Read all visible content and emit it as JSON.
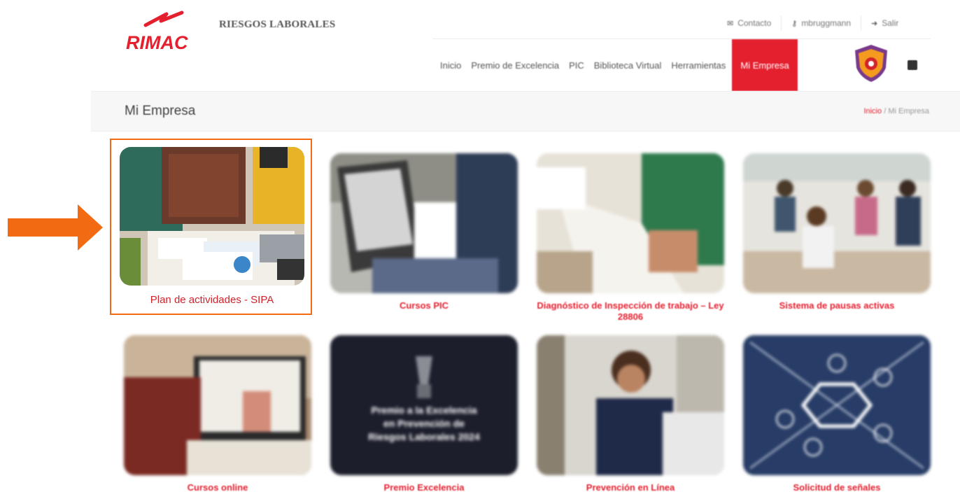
{
  "header": {
    "logo_text": "RIMAC",
    "subtitle": "RIESGOS LABORALES",
    "top_links": [
      {
        "label": "Contacto",
        "icon": "chat-icon"
      },
      {
        "label": "mbruggmann",
        "icon": "key-icon"
      },
      {
        "label": "Salir",
        "icon": "exit-icon"
      }
    ],
    "nav": [
      "Inicio",
      "Premio de Excelencia",
      "PIC",
      "Biblioteca Virtual",
      "Herramientas",
      "Mi Empresa"
    ],
    "active_nav": "Mi Empresa"
  },
  "page": {
    "title": "Mi Empresa",
    "breadcrumb": [
      "Inicio",
      "Mi Empresa"
    ],
    "breadcrumb_sep": "/"
  },
  "tiles": [
    {
      "caption": "Plan de actividades - SIPA",
      "selected": true
    },
    {
      "caption": "Cursos PIC"
    },
    {
      "caption": "Diagnóstico de Inspección de trabajo – Ley 28806"
    },
    {
      "caption": "Sistema de pausas activas"
    },
    {
      "caption": "Cursos online"
    },
    {
      "caption": "Premio Excelencia",
      "image_text": [
        "Premio a la Excelencia",
        "en Prevención de",
        "Riesgos Laborales 2024"
      ]
    },
    {
      "caption": "Prevención en Línea"
    },
    {
      "caption": "Solicitud de señales"
    }
  ],
  "colors": {
    "brand_red": "#e4202f",
    "highlight_orange": "#f26b12"
  }
}
